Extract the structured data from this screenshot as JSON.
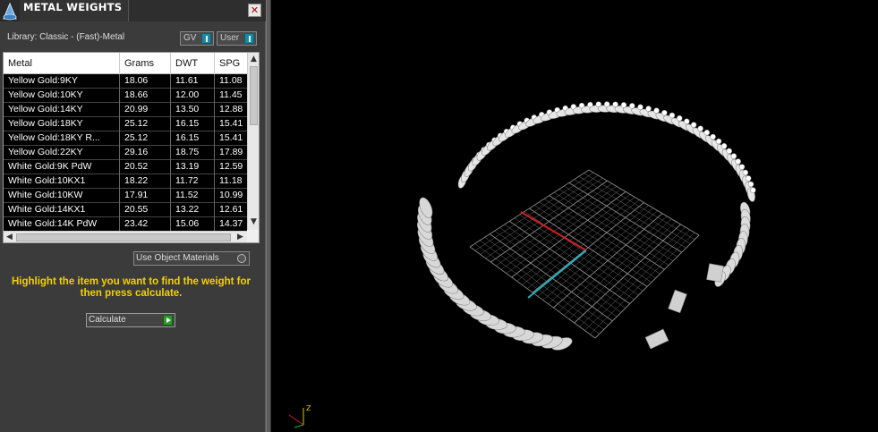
{
  "panel": {
    "title": "METAL WEIGHTS",
    "close_glyph": "✕",
    "library_label": "Library: Classic - (Fast)-Metal",
    "toggles": [
      {
        "label": "GV"
      },
      {
        "label": "User"
      }
    ]
  },
  "table": {
    "columns": [
      "Metal",
      "Grams",
      "DWT",
      "SPG"
    ],
    "rows": [
      {
        "metal": "Yellow Gold:9KY",
        "grams": "18.06",
        "dwt": "11.61",
        "spg": "11.08"
      },
      {
        "metal": "Yellow Gold:10KY",
        "grams": "18.66",
        "dwt": "12.00",
        "spg": "11.45"
      },
      {
        "metal": "Yellow Gold:14KY",
        "grams": "20.99",
        "dwt": "13.50",
        "spg": "12.88"
      },
      {
        "metal": "Yellow Gold:18KY",
        "grams": "25.12",
        "dwt": "16.15",
        "spg": "15.41"
      },
      {
        "metal": "Yellow Gold:18KY R...",
        "grams": "25.12",
        "dwt": "16.15",
        "spg": "15.41"
      },
      {
        "metal": "Yellow Gold:22KY",
        "grams": "29.16",
        "dwt": "18.75",
        "spg": "17.89"
      },
      {
        "metal": "White Gold:9K PdW",
        "grams": "20.52",
        "dwt": "13.19",
        "spg": "12.59"
      },
      {
        "metal": "White Gold:10KX1",
        "grams": "18.22",
        "dwt": "11.72",
        "spg": "11.18"
      },
      {
        "metal": "White Gold:10KW",
        "grams": "17.91",
        "dwt": "11.52",
        "spg": "10.99"
      },
      {
        "metal": "White Gold:14KX1",
        "grams": "20.55",
        "dwt": "13.22",
        "spg": "12.61"
      },
      {
        "metal": "White Gold:14K PdW",
        "grams": "23.42",
        "dwt": "15.06",
        "spg": "14.37"
      }
    ],
    "scroll_up": "▲",
    "scroll_down": "▼",
    "scroll_left": "◀",
    "scroll_right": "▶"
  },
  "use_object_materials": "Use Object Materials",
  "hint": "Highlight the item you want to find the weight for then press calculate.",
  "calculate_label": "Calculate",
  "viewport": {
    "axis_z_label": "Z",
    "axis_x_color": "#d02020",
    "axis_y_color": "#20b0c0",
    "grid_color": "#8a8a8a"
  },
  "colors": {
    "panel_bg": "#3b3b3b",
    "hint_color": "#f5d000",
    "toggle_accent": "#1a8aa0",
    "calc_accent": "#2a9a2a"
  }
}
